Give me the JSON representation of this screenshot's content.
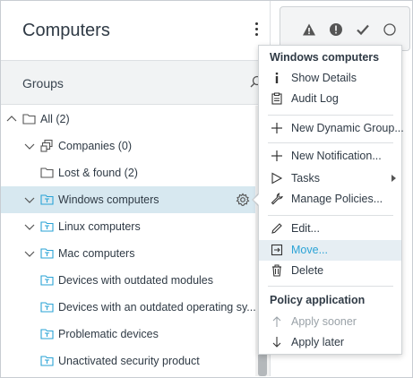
{
  "header": {
    "title": "Computers"
  },
  "groups": {
    "label": "Groups"
  },
  "tree": {
    "items": [
      {
        "label": "All (2)",
        "chevron": "up",
        "icon": "folder"
      },
      {
        "label": "Companies (0)",
        "chevron": "down",
        "icon": "company"
      },
      {
        "label": "Lost & found (2)",
        "chevron": "",
        "icon": "folder"
      },
      {
        "label": "Windows computers",
        "chevron": "down",
        "icon": "static-group",
        "selected": true
      },
      {
        "label": "Linux computers",
        "chevron": "down",
        "icon": "static-group"
      },
      {
        "label": "Mac computers",
        "chevron": "down",
        "icon": "static-group"
      },
      {
        "label": "Devices with outdated modules",
        "chevron": "",
        "icon": "dynamic-group"
      },
      {
        "label": "Devices with an outdated operating sy...",
        "chevron": "",
        "icon": "dynamic-group"
      },
      {
        "label": "Problematic devices",
        "chevron": "",
        "icon": "dynamic-group"
      },
      {
        "label": "Unactivated security product",
        "chevron": "",
        "icon": "dynamic-group"
      }
    ]
  },
  "status_filters": [
    "warning-icon",
    "error-icon",
    "check-icon",
    "circle-icon"
  ],
  "menu": {
    "heading": "Windows computers",
    "items": [
      {
        "label": "Show Details",
        "icon": "info-icon"
      },
      {
        "label": "Audit Log",
        "icon": "clipboard-icon"
      },
      {
        "label": "New Dynamic Group...",
        "icon": "plus-icon"
      },
      {
        "label": "New Notification...",
        "icon": "plus-icon"
      },
      {
        "label": "Tasks",
        "icon": "play-icon",
        "submenu": true
      },
      {
        "label": "Manage Policies...",
        "icon": "wrench-icon"
      },
      {
        "label": "Edit...",
        "icon": "pencil-icon"
      },
      {
        "label": "Move...",
        "icon": "move-icon",
        "hover": true
      },
      {
        "label": "Delete",
        "icon": "trash-icon"
      }
    ],
    "policy_heading": "Policy application",
    "policy_items": [
      {
        "label": "Apply sooner",
        "icon": "arrow-up-icon",
        "disabled": true
      },
      {
        "label": "Apply later",
        "icon": "arrow-down-icon"
      }
    ]
  },
  "colors": {
    "selected_row": "#d7e8f0",
    "group_icon": "#2aa3d6",
    "hover_item": "#e6eef3"
  }
}
